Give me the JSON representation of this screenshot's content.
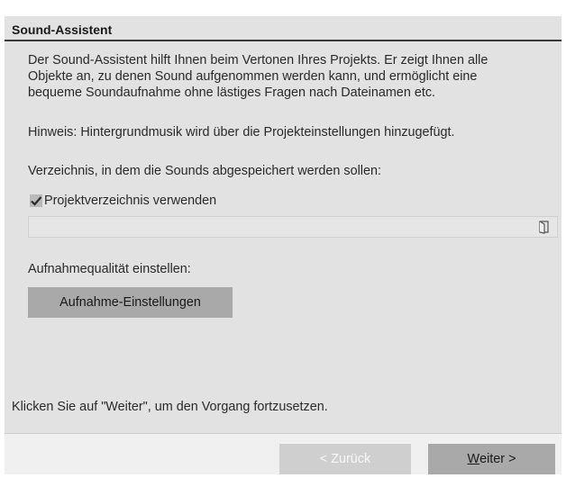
{
  "dialog": {
    "title": "Sound-Assistent",
    "intro_lines": [
      "Der Sound-Assistent hilft Ihnen beim Vertonen Ihres Projekts. Er zeigt Ihnen alle",
      "Objekte an, zu denen Sound aufgenommen werden kann, und ermöglicht eine",
      "bequeme Soundaufnahme ohne lästiges Fragen nach Dateinamen etc."
    ],
    "hint": "Hinweis: Hintergrundmusik wird über die Projekteinstellungen hinzugefügt.",
    "directory_label": "Verzeichnis, in dem die Sounds abgespeichert werden sollen:",
    "use_project_dir": {
      "label": "Projektverzeichnis verwenden",
      "checked": true
    },
    "path_value": "",
    "quality_label": "Aufnahmequalität einstellen:",
    "rec_settings_button": "Aufnahme-Einstellungen",
    "continue_hint": "Klicken Sie auf \"Weiter\", um den Vorgang fortzusetzen.",
    "back_button": "< Zurück",
    "next_button_mnemonic": "W",
    "next_button_rest": "eiter >"
  },
  "icons": {
    "checkbox": "check-icon",
    "browse": "folder-icon"
  },
  "colors": {
    "dialog_bg": "#e2e2e2",
    "header_rule": "#3a3a3a",
    "button_bg": "#a9a9a9",
    "disabled_button_bg": "#cfcfcf"
  }
}
